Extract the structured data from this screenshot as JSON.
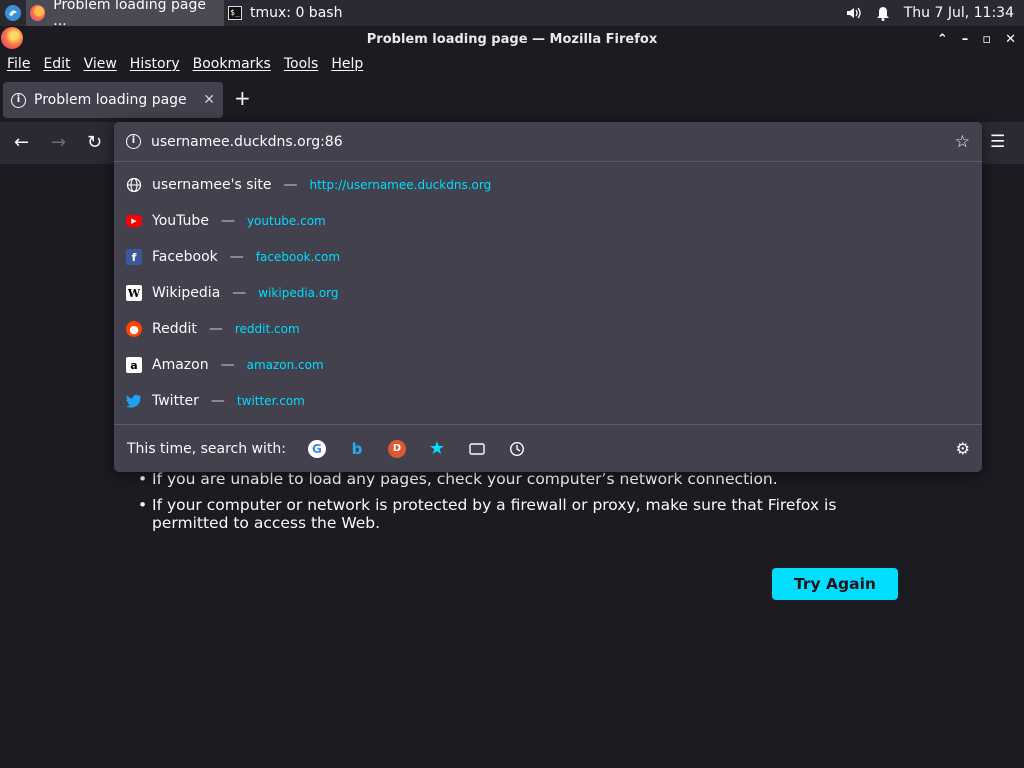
{
  "panel": {
    "tasks": [
      {
        "label": "Problem loading page ...",
        "active": true
      },
      {
        "label": "tmux: 0 bash",
        "active": false
      }
    ],
    "clock": "Thu  7 Jul, 11:34"
  },
  "window": {
    "title": "Problem loading page — Mozilla Firefox"
  },
  "menu": [
    "File",
    "Edit",
    "View",
    "History",
    "Bookmarks",
    "Tools",
    "Help"
  ],
  "tab": {
    "title": "Problem loading page"
  },
  "urlbar": {
    "value": "usernamee.duckdns.org:86"
  },
  "suggestions": [
    {
      "title": "usernamee's site",
      "url": "http://usernamee.duckdns.org",
      "icon": "globe-icon"
    },
    {
      "title": "YouTube",
      "url": "youtube.com",
      "icon": "youtube-icon"
    },
    {
      "title": "Facebook",
      "url": "facebook.com",
      "icon": "facebook-icon"
    },
    {
      "title": "Wikipedia",
      "url": "wikipedia.org",
      "icon": "wikipedia-icon"
    },
    {
      "title": "Reddit",
      "url": "reddit.com",
      "icon": "reddit-icon"
    },
    {
      "title": "Amazon",
      "url": "amazon.com",
      "icon": "amazon-icon"
    },
    {
      "title": "Twitter",
      "url": "twitter.com",
      "icon": "twitter-icon"
    }
  ],
  "search_with": {
    "label": "This time, search with:",
    "engines": [
      "google-icon",
      "bing-icon",
      "duckduckgo-icon",
      "bookmarks-icon",
      "tabs-icon",
      "history-icon"
    ]
  },
  "page": {
    "bullets": [
      "If you are unable to load any pages, check your computer’s network connection.",
      "If your computer or network is protected by a firewall or proxy, make sure that Firefox is permitted to access the Web."
    ],
    "try_again": "Try Again"
  },
  "colors": {
    "accent": "#00ddff",
    "panel_bg": "#42414d",
    "page_bg": "#1c1b22"
  }
}
